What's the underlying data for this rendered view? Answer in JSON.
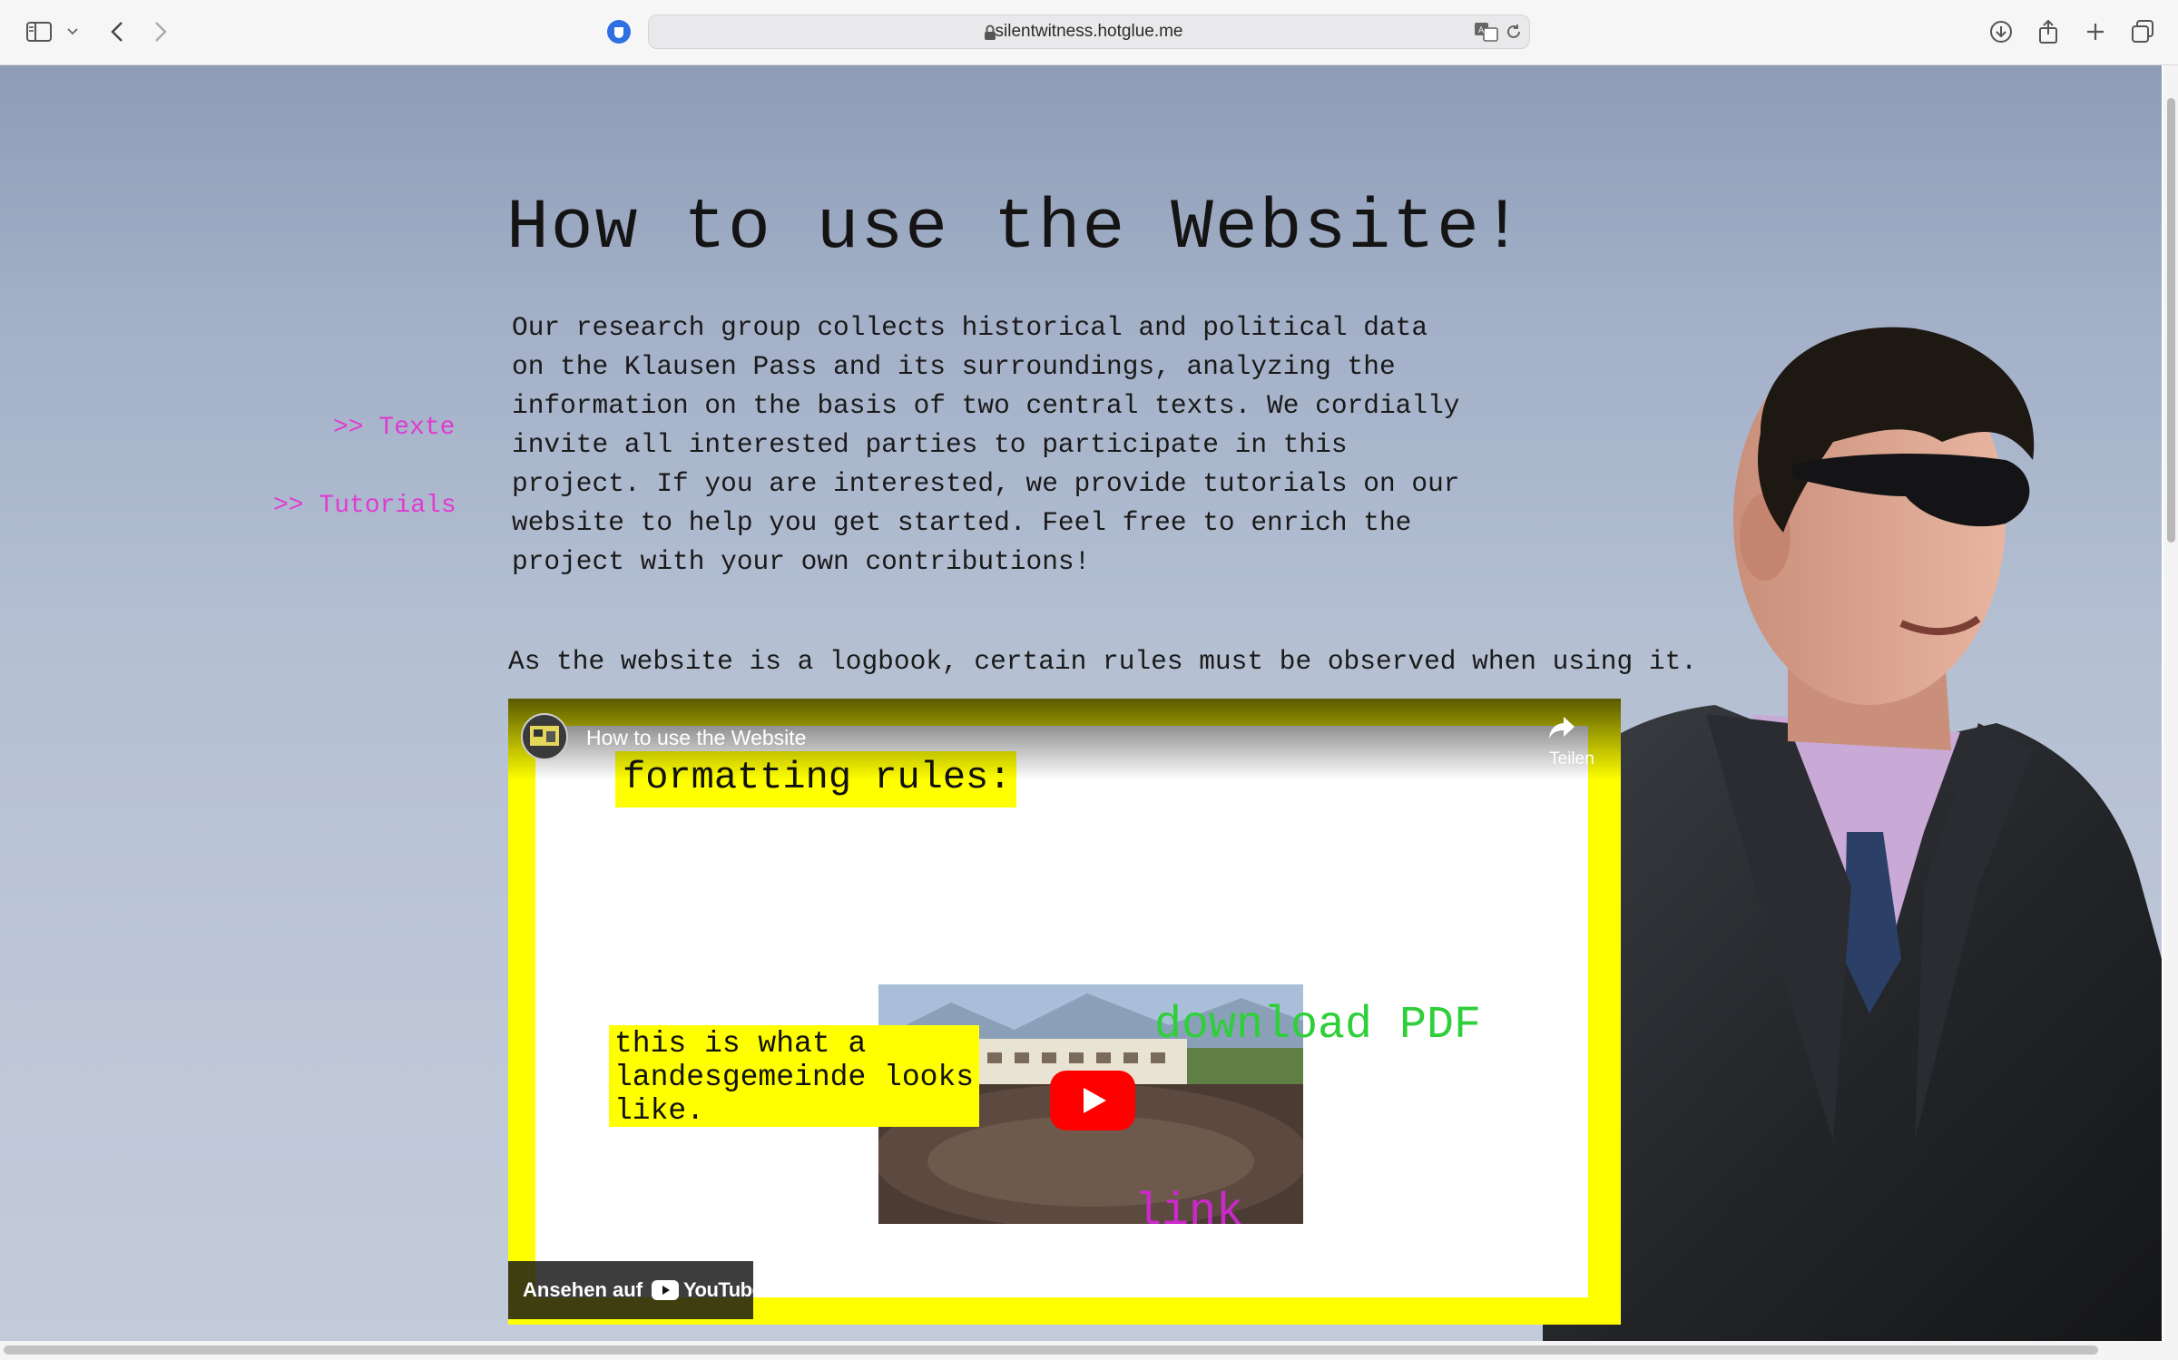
{
  "browser": {
    "url": "silentwitness.hotglue.me",
    "icons": [
      "sidebar-icon",
      "chevron-down-icon",
      "back-icon",
      "forward-icon",
      "privacy-shield-icon",
      "lock-icon",
      "translate-icon",
      "reload-icon",
      "download-icon",
      "share-icon",
      "new-tab-icon",
      "tab-overview-icon"
    ]
  },
  "page": {
    "title": "How to use the Website!",
    "nav": {
      "texte": ">> Texte",
      "tutorials": ">> Tutorials"
    },
    "intro": "Our research group collects historical and political data on the Klausen Pass and its surroundings, analyzing the information on the basis of two central texts. We cordially invite all interested parties to participate in this project. If you are interested, we provide tutorials on our website to help you get started. Feel free to enrich the project with your own contributions!",
    "rules_line": "As the website is a logbook, certain rules must be observed when using it.",
    "link_color": "#e03bd0"
  },
  "video": {
    "title": "How to use the Website",
    "share_label": "Teilen",
    "formatting_label": "formatting rules:",
    "landesgemeinde_label": "this is what a landesgemeinde looks like.",
    "download_label": "download PDF",
    "link_label": "link",
    "watch_on": "Ansehen auf",
    "youtube": "YouTube",
    "frame_color": "#ffff00",
    "download_color": "#2fcf3a",
    "link_color": "#cc28cc"
  }
}
